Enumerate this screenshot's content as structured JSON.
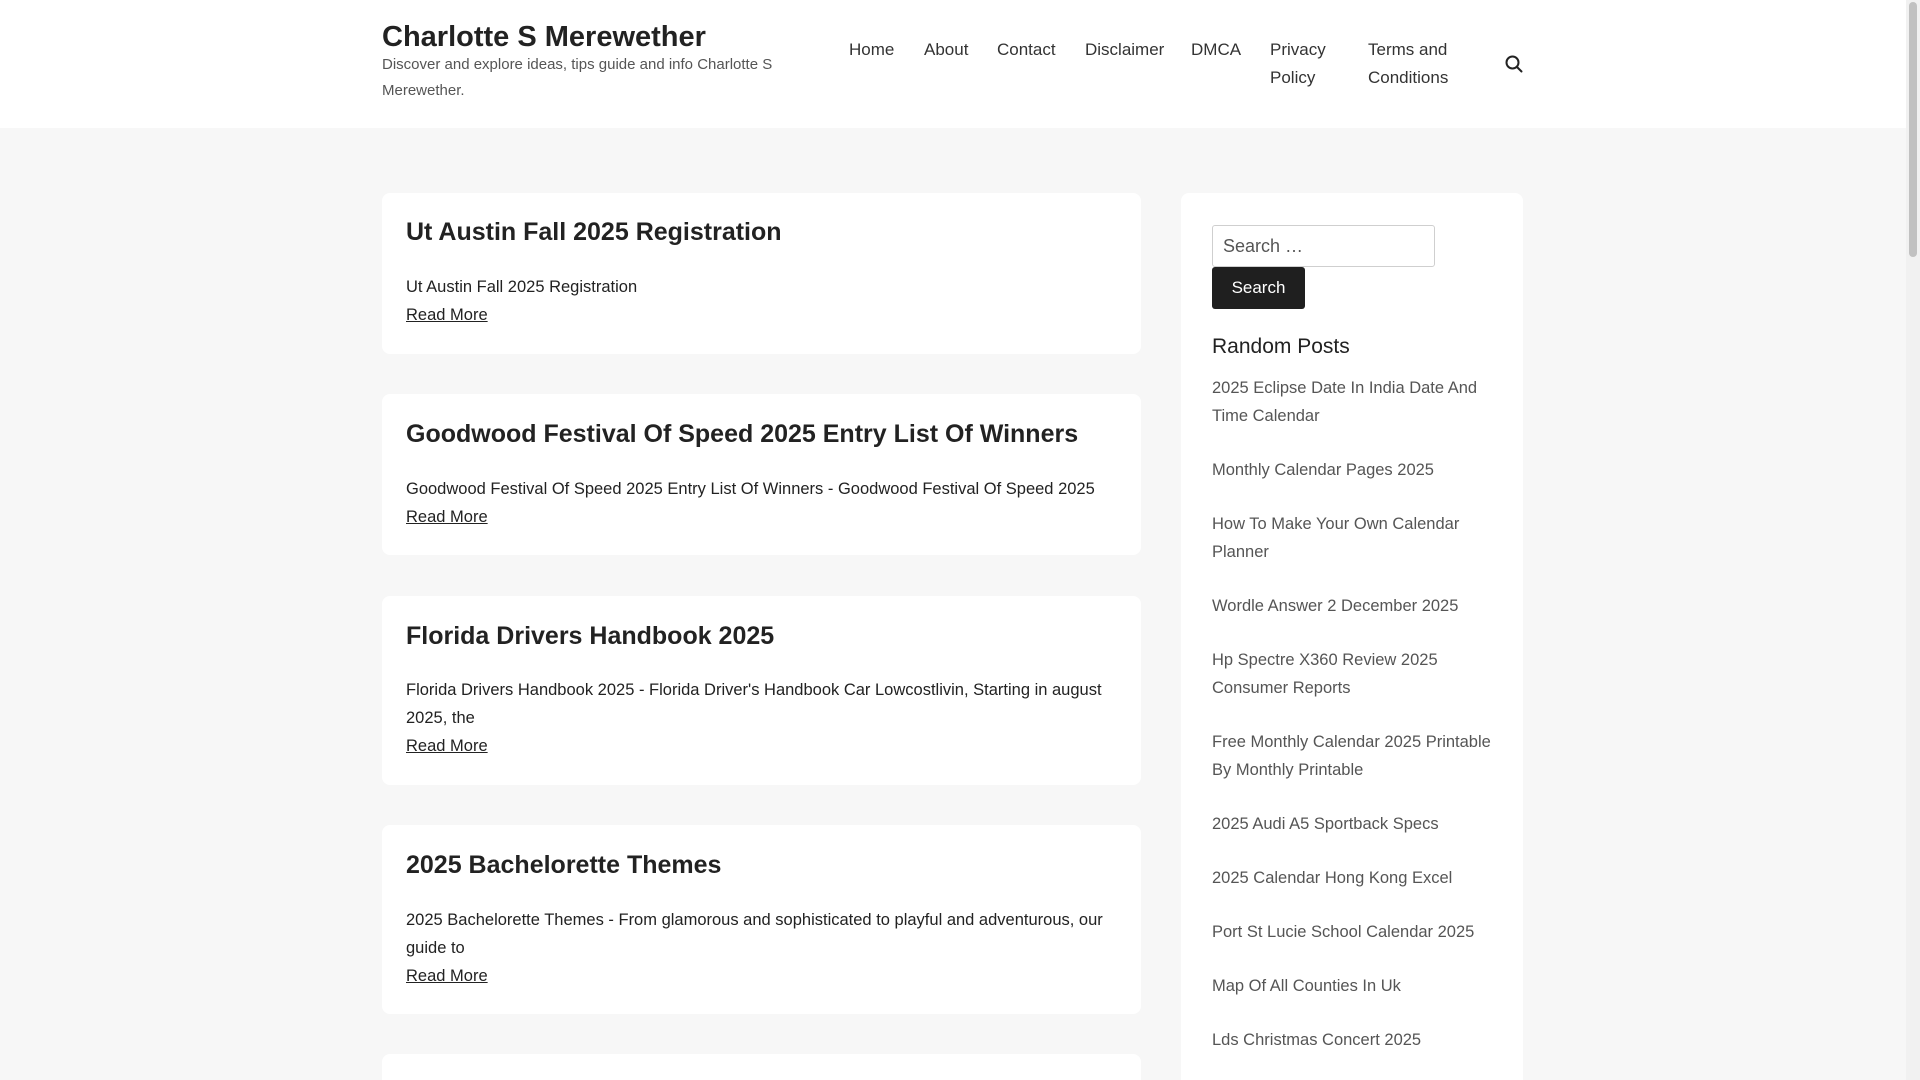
{
  "site": {
    "title": "Charlotte S Merewether",
    "description": "Discover and explore ideas, tips guide and info Charlotte S Merewether."
  },
  "nav": {
    "home": "Home",
    "about": "About",
    "contact": "Contact",
    "disclaimer": "Disclaimer",
    "dmca": "DMCA",
    "privacy_line1": "Privacy",
    "privacy_line2": "Policy",
    "terms_line1": "Terms and",
    "terms_line2": "Conditions",
    "search_icon": "search-icon"
  },
  "posts": [
    {
      "title": "Ut Austin Fall 2025 Registration",
      "excerpt": "Ut Austin Fall 2025 Registration",
      "read_more": "Read More"
    },
    {
      "title": "Goodwood Festival Of Speed 2025 Entry List Of Winners",
      "excerpt": "Goodwood Festival Of Speed 2025 Entry List Of Winners - Goodwood Festival Of Speed 2025",
      "read_more": "Read More"
    },
    {
      "title": "Florida Drivers Handbook 2025",
      "excerpt": "Florida Drivers Handbook 2025 - Florida Driver's Handbook Car Lowcostlivin, Starting in august 2025, the",
      "read_more": "Read More"
    },
    {
      "title": "2025 Bachelorette Themes",
      "excerpt": "2025 Bachelorette Themes - From glamorous and sophisticated to playful and adventurous, our guide to",
      "read_more": "Read More"
    }
  ],
  "sidebar": {
    "search_placeholder": "Search …",
    "search_button": "Search",
    "random_title": "Random Posts",
    "random_posts": [
      "2025 Eclipse Date In India Date And Time Calendar",
      "Monthly Calendar Pages 2025",
      "How To Make Your Own Calendar Planner",
      "Wordle Answer 2 December 2025",
      "Hp Spectre X360 Review 2025 Consumer Reports",
      "Free Monthly Calendar 2025 Printable By Monthly Printable",
      "2025 Audi A5 Sportback Specs",
      "2025 Calendar Hong Kong Excel",
      "Port St Lucie School Calendar 2025",
      "Map Of All Counties In Uk",
      "Lds Christmas Concert 2025"
    ]
  },
  "colors": {
    "page_bg": "#f7f7f7",
    "card_bg": "#ffffff",
    "button_bg": "#1f1f1f",
    "text": "#222222",
    "muted": "#555555"
  }
}
